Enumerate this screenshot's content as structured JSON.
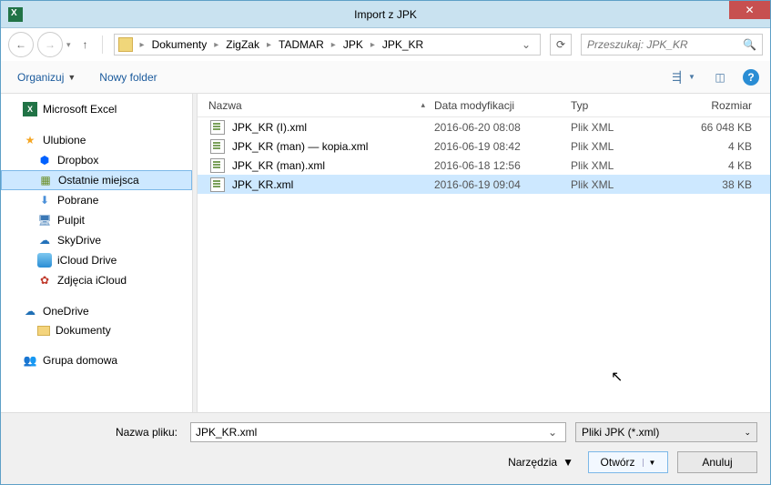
{
  "title": "Import z JPK",
  "breadcrumb": [
    "Dokumenty",
    "ZigZak",
    "TADMAR",
    "JPK",
    "JPK_KR"
  ],
  "search_placeholder": "Przeszukaj: JPK_KR",
  "toolbar": {
    "organize": "Organizuj",
    "newfolder": "Nowy folder"
  },
  "sidebar": {
    "excel": "Microsoft Excel",
    "fav": "Ulubione",
    "dropbox": "Dropbox",
    "recent": "Ostatnie miejsca",
    "downloads": "Pobrane",
    "desktop": "Pulpit",
    "skydrive": "SkyDrive",
    "iclouddrive": "iCloud Drive",
    "icloudphotos": "Zdjęcia iCloud",
    "onedrive": "OneDrive",
    "documents": "Dokumenty",
    "homegroup": "Grupa domowa"
  },
  "columns": {
    "name": "Nazwa",
    "date": "Data modyfikacji",
    "type": "Typ",
    "size": "Rozmiar"
  },
  "files": [
    {
      "name": "JPK_KR (I).xml",
      "date": "2016-06-20 08:08",
      "type": "Plik XML",
      "size": "66 048 KB"
    },
    {
      "name": "JPK_KR (man) — kopia.xml",
      "date": "2016-06-19 08:42",
      "type": "Plik XML",
      "size": "4 KB"
    },
    {
      "name": "JPK_KR (man).xml",
      "date": "2016-06-18 12:56",
      "type": "Plik XML",
      "size": "4 KB"
    },
    {
      "name": "JPK_KR.xml",
      "date": "2016-06-19 09:04",
      "type": "Plik XML",
      "size": "38 KB"
    }
  ],
  "selected_file_index": 3,
  "bottom": {
    "filename_label": "Nazwa pliku:",
    "filename_value": "JPK_KR.xml",
    "filter": "Pliki JPK (*.xml)",
    "tools": "Narzędzia",
    "open": "Otwórz",
    "cancel": "Anuluj"
  }
}
